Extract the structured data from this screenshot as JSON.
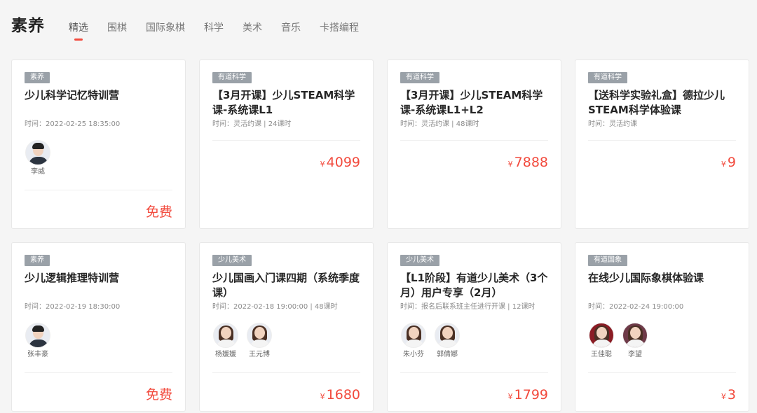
{
  "header": {
    "title": "素养",
    "tabs": [
      "精选",
      "围棋",
      "国际象棋",
      "科学",
      "美术",
      "音乐",
      "卡搭编程"
    ],
    "active_tab": "精选"
  },
  "currency": "¥",
  "free_label": "免费",
  "cards": [
    {
      "tag": "素养",
      "title": "少儿科学记忆特训营",
      "meta": "时间：2022-02-25 18:35:00",
      "teachers": [
        "李威"
      ],
      "price": ""
    },
    {
      "tag": "有道科学",
      "title": "【3月开课】少儿STEAM科学课-系统课L1",
      "meta": "时间：灵活约课 | 24课时",
      "teachers": [],
      "price": "4099"
    },
    {
      "tag": "有道科学",
      "title": "【3月开课】少儿STEAM科学课-系统课L1+L2",
      "meta": "时间：灵活约课 | 48课时",
      "teachers": [],
      "price": "7888"
    },
    {
      "tag": "有道科学",
      "title": "【送科学实验礼盒】德拉少儿STEAM科学体验课",
      "meta": "时间：灵活约课",
      "teachers": [],
      "price": "9"
    },
    {
      "tag": "素养",
      "title": "少儿逻辑推理特训营",
      "meta": "时间：2022-02-19 18:30:00",
      "teachers": [
        "张丰豪"
      ],
      "price": ""
    },
    {
      "tag": "少儿美术",
      "title": "少儿国画入门课四期（系统季度课）",
      "meta": "时间：2022-02-18 19:00:00 | 48课时",
      "teachers": [
        "杨媛媛",
        "王元博"
      ],
      "price": "1680"
    },
    {
      "tag": "少儿美术",
      "title": "【L1阶段】有道少儿美术（3个月）用户专享（2月）",
      "meta": "时间：报名后联系班主任进行开课 | 12课时",
      "teachers": [
        "朱小芬",
        "郭倩娜"
      ],
      "price": "1799"
    },
    {
      "tag": "有道国象",
      "title": "在线少儿国际象棋体验课",
      "meta": "时间：2022-02-24 19:00:00",
      "teachers": [
        "王佳聪",
        "李望"
      ],
      "price": "3"
    }
  ]
}
